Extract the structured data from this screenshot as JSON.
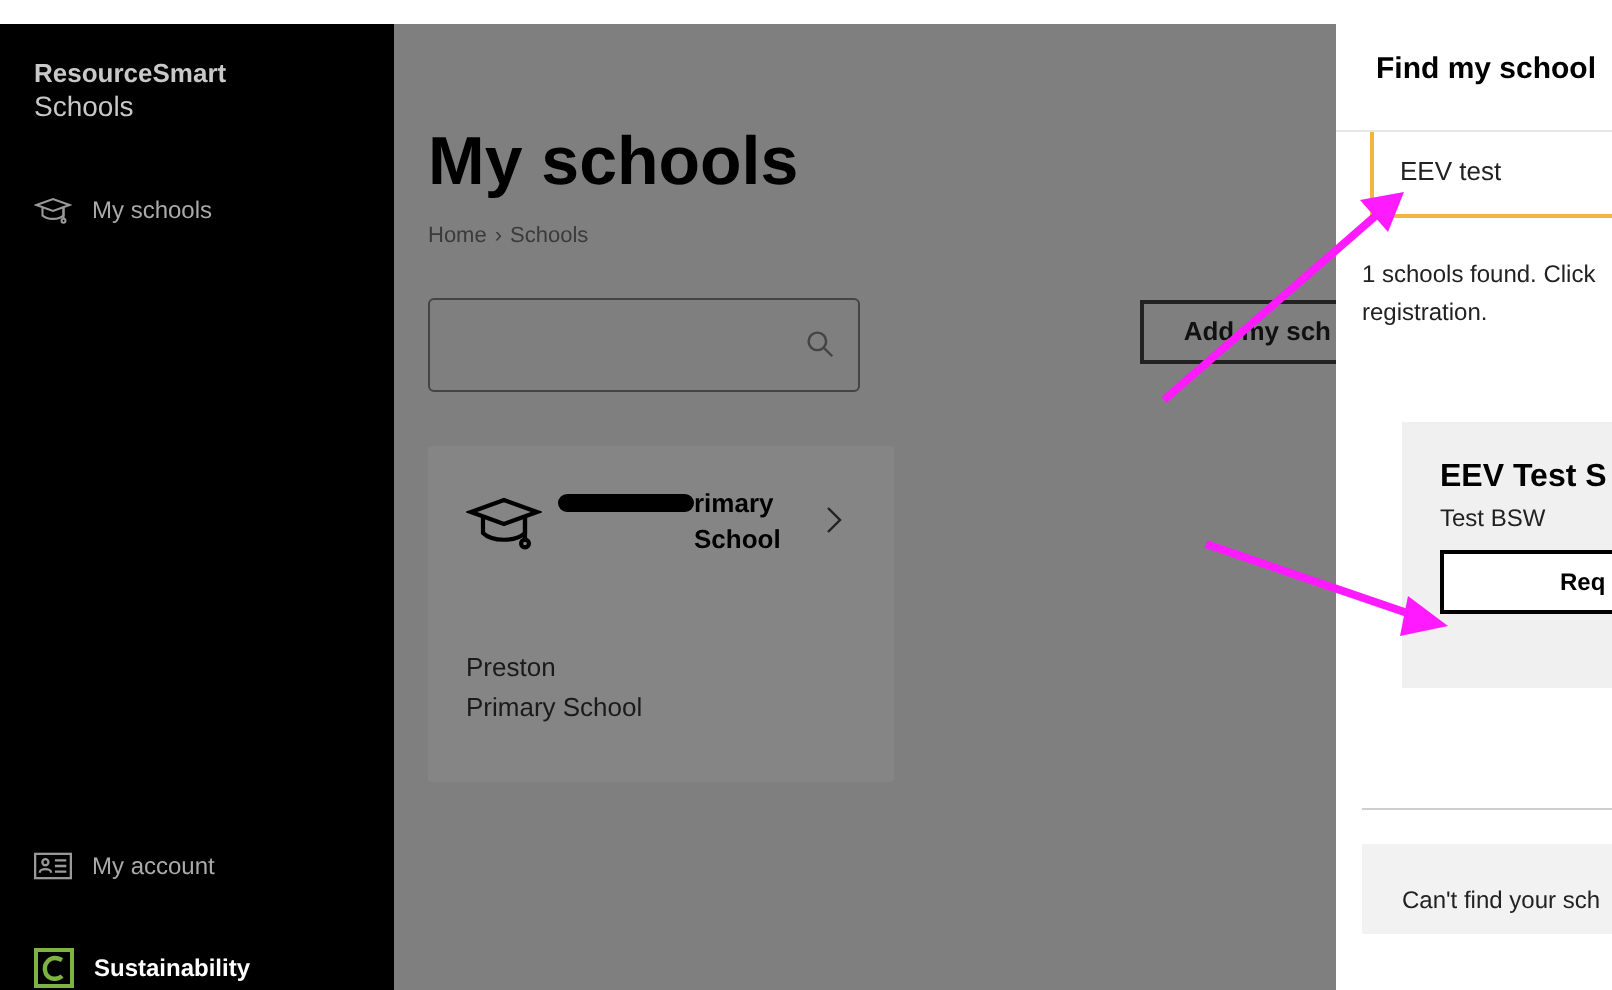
{
  "sidebar": {
    "brand": {
      "name": "ResourceSmart",
      "subtitle": "Schools"
    },
    "items": [
      {
        "label": "My schools",
        "kind": "schools"
      }
    ],
    "footer_items": [
      {
        "label": "My account",
        "kind": "account"
      },
      {
        "label": "Sustainability",
        "kind": "logo"
      }
    ]
  },
  "main": {
    "title": "My schools",
    "breadcrumb": [
      "Home",
      "Schools"
    ],
    "breadcrumb_separator": "›",
    "add_button": "Add my sch",
    "schools": [
      {
        "name": "rimary School",
        "redacted": true,
        "address": [
          "Preston",
          "Primary School"
        ]
      }
    ]
  },
  "panel": {
    "title": "Find my school",
    "search_value": "EEV test",
    "result_text": "1 schools found. Click",
    "result_text_2": "registration.",
    "results": [
      {
        "name": "EEV Test S",
        "subtitle": "Test BSW",
        "button": "Req"
      }
    ],
    "footer_text": "Can't find your sch"
  },
  "annotations": [
    {
      "kind": "arrow"
    },
    {
      "kind": "arrow"
    }
  ]
}
